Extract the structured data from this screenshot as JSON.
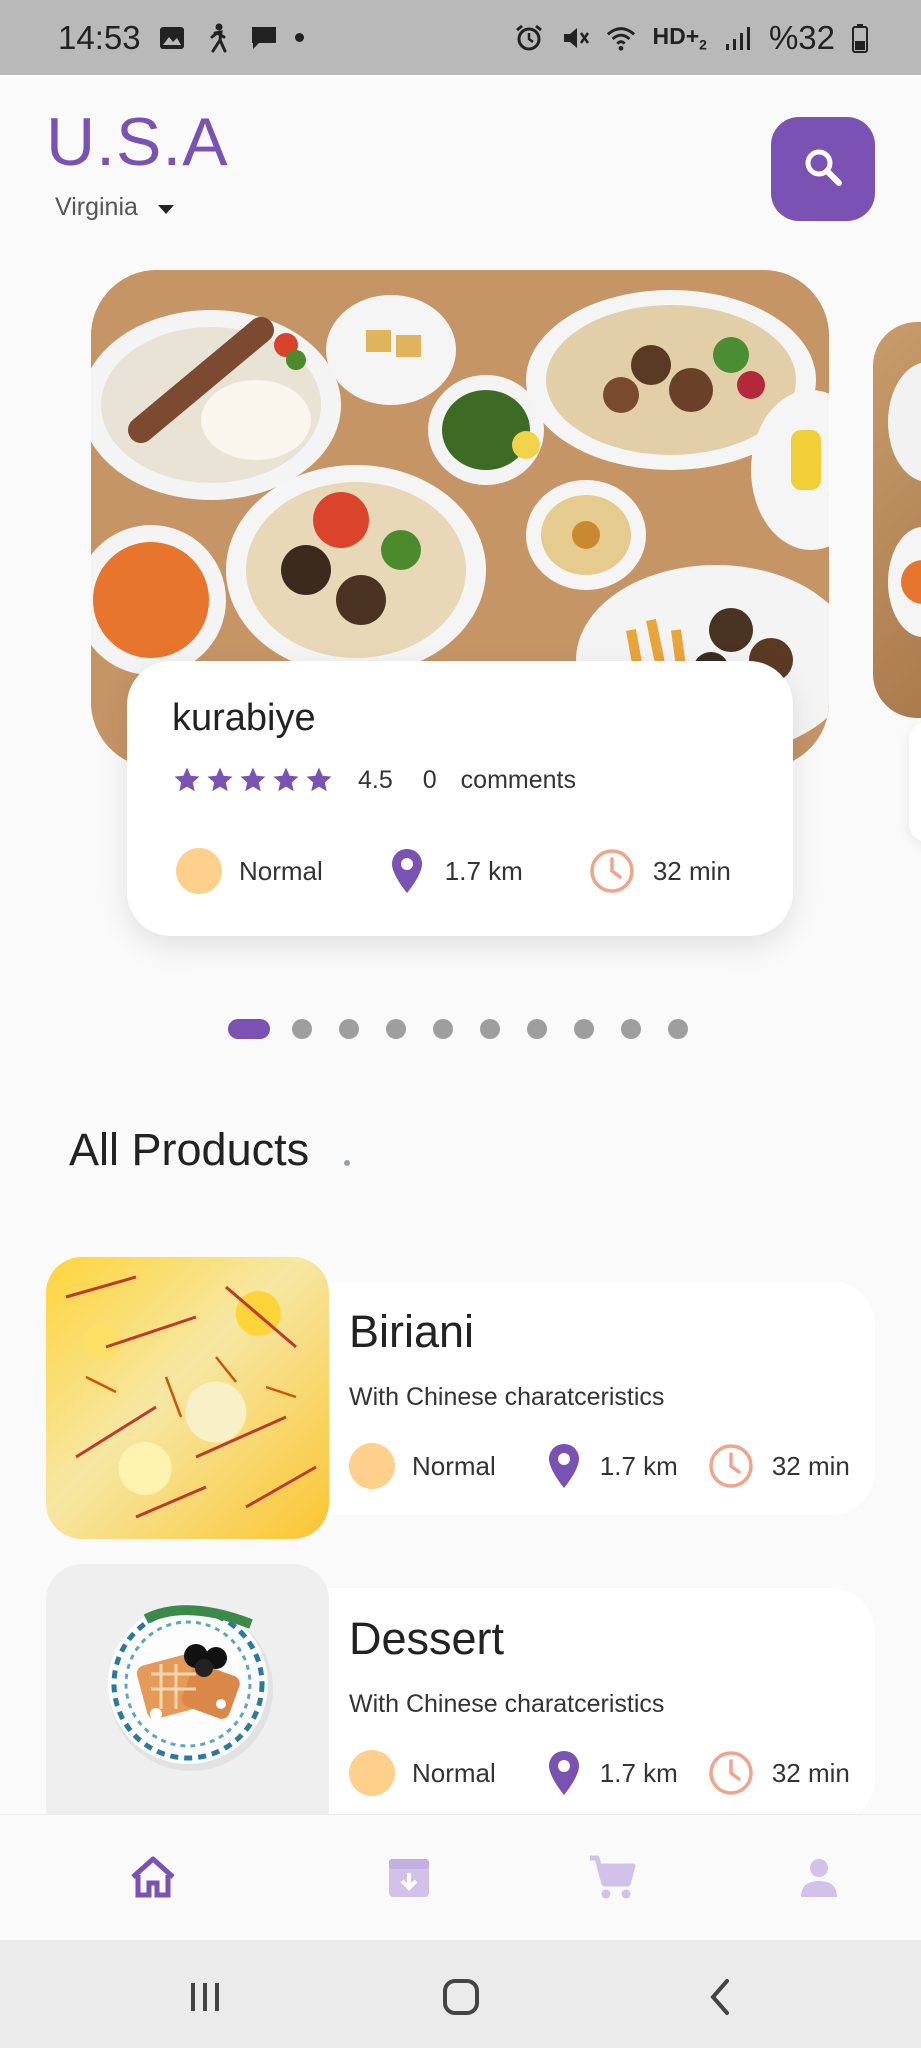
{
  "status_bar": {
    "time": "14:53",
    "network": "HD+",
    "network_sub": "2",
    "battery": "%32",
    "icons": [
      "image-icon",
      "accessibility-icon",
      "message-icon",
      "alarm-icon",
      "mute-icon",
      "wifi-icon",
      "signal-icon",
      "battery-icon"
    ]
  },
  "header": {
    "country": "U.S.A",
    "region": "Virginia",
    "search_icon": "search-icon"
  },
  "featured": {
    "title": "kurabiye",
    "rating": "4.5",
    "stars": 5,
    "comments_count": "0",
    "comments_label": "comments",
    "level": "Normal",
    "distance": "1.7 km",
    "time": "32 min"
  },
  "carousel": {
    "total": 10,
    "active_index": 0
  },
  "section": {
    "title": "All Products"
  },
  "products": [
    {
      "name": "Biriani",
      "description": "With Chinese charatceristics",
      "level": "Normal",
      "distance": "1.7 km",
      "time": "32 min"
    },
    {
      "name": "Dessert",
      "description": "With Chinese charatceristics",
      "level": "Normal",
      "distance": "1.7 km",
      "time": "32 min"
    }
  ],
  "bottom_nav": {
    "items": [
      "home-icon",
      "archive-icon",
      "cart-icon",
      "profile-icon"
    ],
    "active": "home-icon"
  },
  "colors": {
    "accent": "#7a52b3",
    "level_dot": "#ffcf8c",
    "clock": "#f0a58a"
  }
}
